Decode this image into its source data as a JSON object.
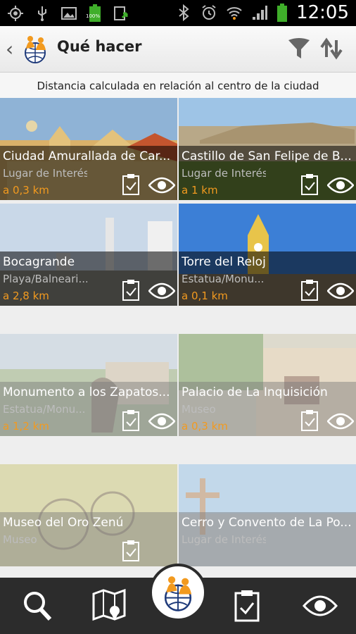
{
  "statusbar": {
    "time": "12:05",
    "battery_percent_label": "100%",
    "icons": [
      "gps-icon",
      "usb-icon",
      "image-icon",
      "battery-icon",
      "upload-icon",
      "bluetooth-icon",
      "alarm-icon",
      "wifi-icon",
      "signal-icon",
      "battery-full-icon"
    ]
  },
  "header": {
    "title": "Qué hacer",
    "icons": [
      "back-icon",
      "app-logo-icon",
      "filter-icon",
      "sort-icon"
    ]
  },
  "subtitle": "Distancia calculada en relación al centro de la ciudad",
  "places": [
    {
      "name": "Ciudad Amurallada de Car...",
      "category": "Lugar de Interés",
      "distance": "a 0,3 km"
    },
    {
      "name": "Castillo de San Felipe de B...",
      "category": "Lugar de Interés",
      "distance": "a 1 km"
    },
    {
      "name": "Bocagrande",
      "category": "Playa/Balneari...",
      "distance": "a 2,8 km"
    },
    {
      "name": "Torre del Reloj",
      "category": "Estatua/Monu...",
      "distance": "a 0,1 km"
    },
    {
      "name": "Monumento a los Zapatos...",
      "category": "Estatua/Monu...",
      "distance": "a 1,2 km"
    },
    {
      "name": "Palacio de La Inquisición",
      "category": "Museo",
      "distance": "a 0,3 km"
    },
    {
      "name": "Museo del Oro Zenú",
      "category": "Museo",
      "distance": ""
    },
    {
      "name": "Cerro y Convento de La Po...",
      "category": "Lugar de Interés",
      "distance": ""
    }
  ],
  "bottom_nav": [
    "search-icon",
    "map-icon",
    "home-logo-icon",
    "planner-icon",
    "seen-icon"
  ],
  "colors": {
    "accent": "#f29a1f",
    "bar": "#2c2c2c"
  }
}
